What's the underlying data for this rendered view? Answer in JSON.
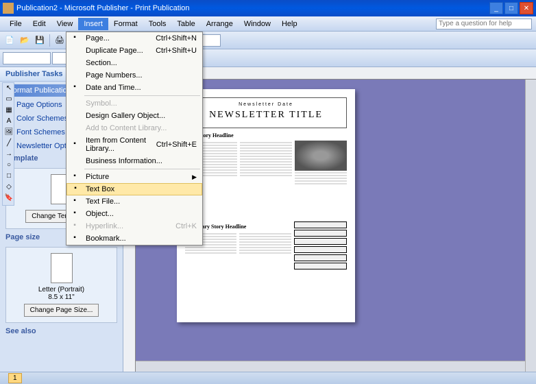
{
  "window": {
    "title": "Publication2 - Microsoft Publisher - Print Publication",
    "help_placeholder": "Type a question for help"
  },
  "menubar": {
    "items": [
      "File",
      "Edit",
      "View",
      "Insert",
      "Format",
      "Tools",
      "Table",
      "Arrange",
      "Window",
      "Help"
    ],
    "active_index": 3
  },
  "dropdown": {
    "items": [
      {
        "label": "Page...",
        "shortcut": "Ctrl+Shift+N",
        "icon": "page"
      },
      {
        "label": "Duplicate Page...",
        "shortcut": "Ctrl+Shift+U"
      },
      {
        "label": "Section..."
      },
      {
        "label": "Page Numbers..."
      },
      {
        "label": "Date and Time...",
        "icon": "clock"
      },
      {
        "type": "sep"
      },
      {
        "label": "Symbol...",
        "disabled": true
      },
      {
        "label": "Design Gallery Object..."
      },
      {
        "label": "Add to Content Library...",
        "disabled": true
      },
      {
        "label": "Item from Content Library...",
        "shortcut": "Ctrl+Shift+E",
        "icon": "lib"
      },
      {
        "label": "Business Information..."
      },
      {
        "type": "sep"
      },
      {
        "label": "Picture",
        "submenu": true,
        "icon": "pic"
      },
      {
        "label": "Text Box",
        "highlighted": true,
        "icon": "textbox"
      },
      {
        "label": "Text File...",
        "icon": "file"
      },
      {
        "label": "Object...",
        "icon": "obj"
      },
      {
        "label": "Hyperlink...",
        "shortcut": "Ctrl+K",
        "disabled": true,
        "icon": "link"
      },
      {
        "label": "Bookmark...",
        "icon": "bookmark"
      }
    ]
  },
  "taskpane": {
    "title": "Publisher Tasks",
    "header": "Format Publication",
    "options": [
      {
        "label": "Page Options",
        "icon": "page"
      },
      {
        "label": "Color Schemes",
        "icon": "color"
      },
      {
        "label": "Font Schemes",
        "icon": "font"
      },
      {
        "label": "Newsletter Options",
        "icon": "nl"
      }
    ],
    "template_section": "Template",
    "change_template_btn": "Change Template...",
    "pagesize_section": "Page size",
    "page_label": "Letter (Portrait)",
    "page_dims": "8.5 x 11\"",
    "change_size_btn": "Change Page Size...",
    "see_also": "See also"
  },
  "document": {
    "header_text": "Newsletter Date",
    "title": "NEWSLETTER TITLE",
    "lead_story": "Lead Story Headline",
    "secondary_story": "Secondary Story Headline"
  },
  "toolbar": {
    "font_name": "",
    "font_size": ""
  },
  "status": {
    "page_label": "1"
  }
}
